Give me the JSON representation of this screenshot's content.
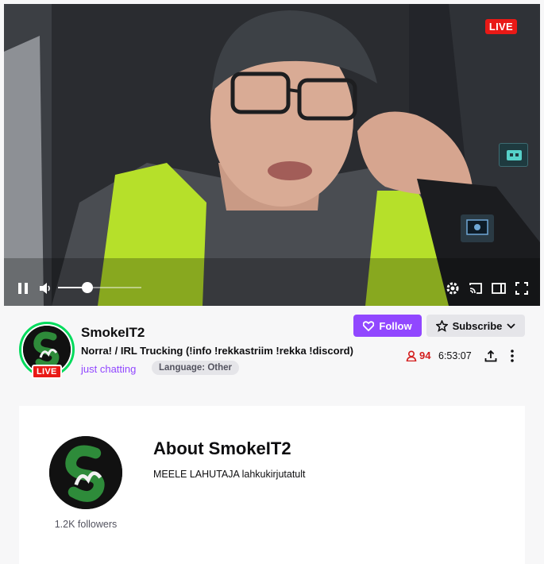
{
  "player": {
    "live_label": "LIVE",
    "volume_level": 0.35,
    "icons": [
      "pause-icon",
      "volume-icon",
      "settings-icon",
      "cast-icon",
      "theatre-mode-icon",
      "fullscreen-icon"
    ]
  },
  "channel": {
    "name": "SmokeIT2",
    "avatar_live_label": "LIVE",
    "stream_title": "Norra! / IRL Trucking (!info !rekkastriim !rekka !discord)",
    "category": "just chatting",
    "tag": "Language: Other",
    "follow_label": "Follow",
    "subscribe_label": "Subscribe",
    "viewer_count": "94",
    "uptime": "6:53:07"
  },
  "about": {
    "title": "About SmokeIT2",
    "description": "MEELE LAHUTAJA lahkukirjutatult",
    "followers": "1.2K followers"
  },
  "colors": {
    "accent": "#9147ff",
    "live": "#e91916",
    "live_ring": "#00db5c",
    "viewer": "#d31d1d"
  }
}
